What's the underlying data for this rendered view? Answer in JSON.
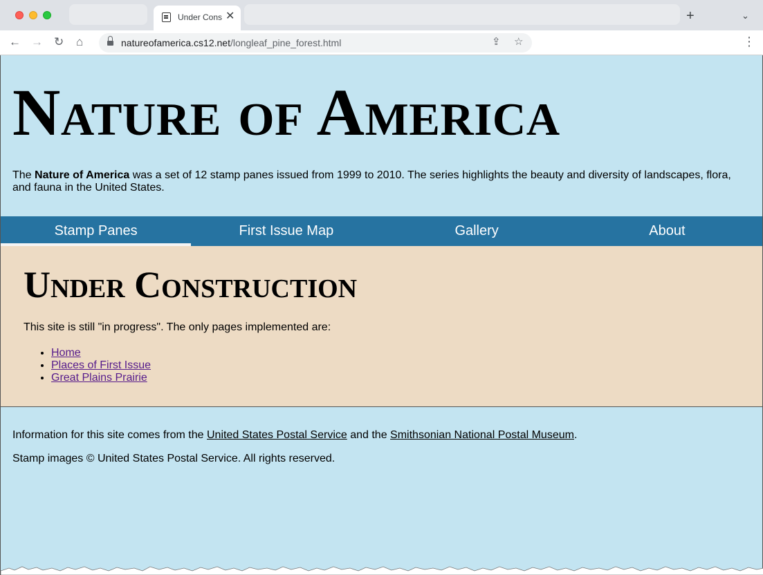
{
  "browser": {
    "tab_title": "Under Construction",
    "url_host": "natureofamerica.cs12.net",
    "url_path": "/longleaf_pine_forest.html"
  },
  "site": {
    "title": "Nature of America",
    "intro_prefix": "The ",
    "intro_bold": "Nature of America",
    "intro_suffix": " was a set of 12 stamp panes issued from 1999 to 2010. The series highlights the beauty and diversity of landscapes, flora, and fauna in the United States."
  },
  "nav": {
    "items": [
      {
        "label": "Stamp Panes",
        "active": true
      },
      {
        "label": "First Issue Map",
        "active": false
      },
      {
        "label": "Gallery",
        "active": false
      },
      {
        "label": "About",
        "active": false
      }
    ]
  },
  "main": {
    "heading": "Under Construction",
    "text": "This site is still \"in progress\". The only pages implemented are:",
    "links": [
      "Home",
      "Places of First Issue",
      "Great Plains Prairie"
    ]
  },
  "footer": {
    "line1_prefix": "Information for this site comes from the ",
    "link1": "United States Postal Service",
    "line1_middle": " and the ",
    "link2": "Smithsonian National Postal Museum",
    "line1_suffix": ".",
    "line2": "Stamp images © United States Postal Service. All rights reserved."
  },
  "colors": {
    "header_bg": "#c3e4f1",
    "nav_bg": "#2673a1",
    "main_bg": "#eddbc4",
    "visited_link": "#551a8b"
  }
}
